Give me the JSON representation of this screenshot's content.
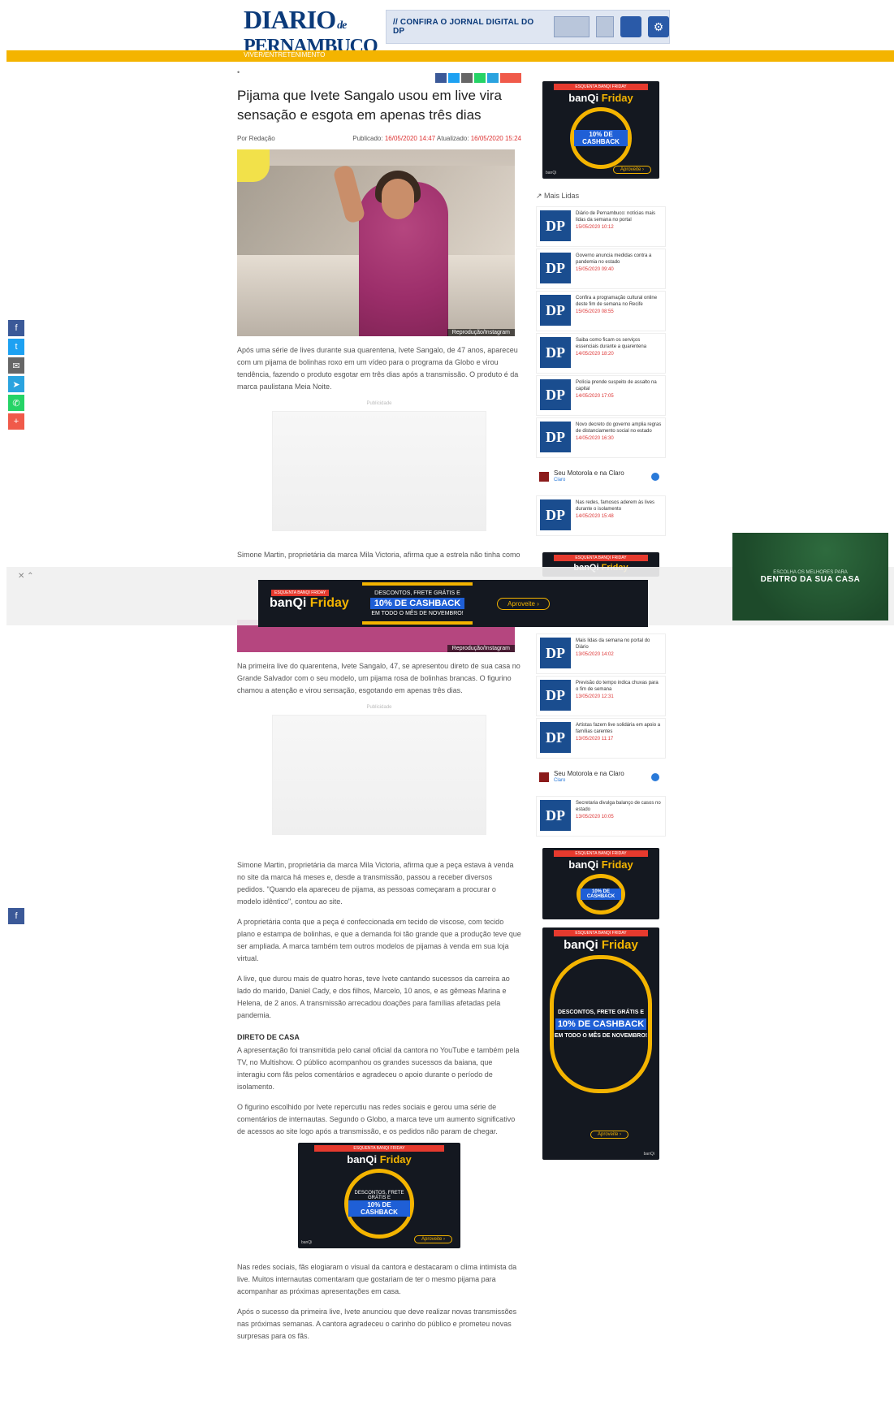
{
  "header": {
    "logo_line1": "DIARIO",
    "logo_de": "de",
    "logo_line2": "PERNAMBUCO",
    "banner_text": "// CONFIRA O JORNAL DIGITAL DO DP",
    "category_strip": "VIVER/ENTRETENIMENTO"
  },
  "article": {
    "title": "Pijama que Ivete Sangalo usou em live vira sensação e esgota em apenas três dias",
    "author": "Por Redação",
    "date_label": "Publicado:",
    "date_value": "16/05/2020 14:47",
    "updated_label": "Atualizado:",
    "updated_value": "16/05/2020 15:24",
    "photo_caption": "Reprodução/Instagram",
    "paragraphs": [
      "Após uma série de lives durante sua quarentena, Ivete Sangalo, de 47 anos, apareceu com um pijama de bolinhas roxo em um vídeo para o programa da Globo e virou tendência, fazendo o produto esgotar em três dias após a transmissão. O produto é da marca paulistana Meia Noite.",
      "Simone Martin, proprietária da marca Mila Victoria, afirma que a estrela não tinha como comprar a peça.",
      "Na primeira live do quarentena, Ivete Sangalo, 47, se apresentou direto de sua casa no Grande Salvador com o seu modelo, um pijama rosa de bolinhas brancas. O figurino chamou a atenção e virou sensação, esgotando em apenas três dias.",
      "Simone Martin, proprietária da marca Mila Victoria, afirma que a peça estava à venda no site da marca há meses e, desde a transmissão, passou a receber diversos pedidos. \"Quando ela apareceu de pijama, as pessoas começaram a procurar o modelo idêntico\", contou ao site.",
      "A proprietária conta que a peça é confeccionada em tecido de viscose, com tecido plano e estampa de bolinhas, e que a demanda foi tão grande que a produção teve que ser ampliada. A marca também tem outros modelos de pijamas à venda em sua loja virtual.",
      "A live, que durou mais de quatro horas, teve Ivete cantando sucessos da carreira ao lado do marido, Daniel Cady, e dos filhos, Marcelo, 10 anos, e as gêmeas Marina e Helena, de 2 anos. A transmissão arrecadou doações para famílias afetadas pela pandemia."
    ],
    "subhead": "DIRETO DE CASA",
    "paragraphs2": [
      "A apresentação foi transmitida pelo canal oficial da cantora no YouTube e também pela TV, no Multishow. O público acompanhou os grandes sucessos da baiana, que interagiu com fãs pelos comentários e agradeceu o apoio durante o período de isolamento.",
      "O figurino escolhido por Ivete repercutiu nas redes sociais e gerou uma série de comentários de internautas. Segundo o Globo, a marca teve um aumento significativo de acessos ao site logo após a transmissão, e os pedidos não param de chegar.",
      "Nas redes sociais, fãs elogiaram o visual da cantora e destacaram o clima intimista da live. Muitos internautas comentaram que gostariam de ter o mesmo pijama para acompanhar as próximas apresentações em casa.",
      "Após o sucesso da primeira live, Ivete anunciou que deve realizar novas transmissões nas próximas semanas. A cantora agradeceu o carinho do público e prometeu novas surpresas para os fãs."
    ],
    "ad_label": "Publicidade"
  },
  "sidebar": {
    "trending_title": "Mais Lidas",
    "trending": [
      {
        "text": "Diário de Pernambuco: notícias mais lidas da semana no portal",
        "date": "15/05/2020 10:12"
      },
      {
        "text": "Governo anuncia medidas contra a pandemia no estado",
        "date": "15/05/2020 09:40"
      },
      {
        "text": "Confira a programação cultural online deste fim de semana no Recife",
        "date": "15/05/2020 08:55"
      },
      {
        "text": "Saiba como ficam os serviços essenciais durante a quarentena",
        "date": "14/05/2020 18:20"
      },
      {
        "text": "Polícia prende suspeito de assalto na capital",
        "date": "14/05/2020 17:05"
      },
      {
        "text": "Novo decreto do governo amplia regras de distanciamento social no estado",
        "date": "14/05/2020 16:30"
      },
      {
        "text": "Nas redes, famosos aderem às lives durante o isolamento",
        "date": "14/05/2020 15:48"
      }
    ],
    "trending2": [
      {
        "text": "Mais lidas da semana no portal do Diário",
        "date": "13/05/2020 14:02"
      },
      {
        "text": "Previsão do tempo indica chuvas para o fim de semana",
        "date": "13/05/2020 12:31"
      },
      {
        "text": "Artistas fazem live solidária em apoio a famílias carentes",
        "date": "13/05/2020 11:17"
      },
      {
        "text": "Secretaria divulga balanço de casos no estado",
        "date": "13/05/2020 10:05"
      }
    ],
    "sponsor_title": "Seu Motorola e na Claro",
    "sponsor_sub": "Claro"
  },
  "ads": {
    "banqi_top": "ESQUENTA BANQI FRIDAY",
    "banqi_brand_a": "banQi",
    "banqi_brand_b": "Friday",
    "banqi_desc": "DESCONTOS, FRETE GRÁTIS E",
    "banqi_cash": "10% DE CASHBACK",
    "banqi_period": "EM TODO O MÊS DE NOVEMBRO!",
    "banqi_cta": "Aproveite ›",
    "banqi_foot": "banQi",
    "green_small": "ESCOLHA OS MELHORES PARA",
    "green_big": "DENTRO DA SUA CASA"
  },
  "colors": {
    "yellow": "#f4b400",
    "brand_blue": "#0b3a7a",
    "dp_blue": "#1a4d8f"
  }
}
